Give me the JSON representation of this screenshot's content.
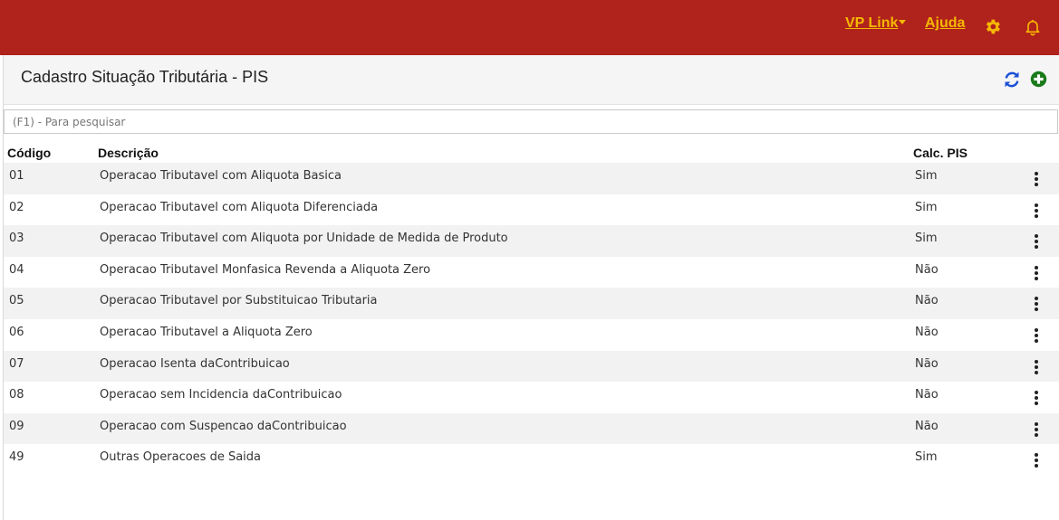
{
  "topbar": {
    "vp_link_label": "VP Link",
    "help_label": "Ajuda",
    "icons": [
      "chevron-down-icon",
      "gear-icon",
      "bell-icon"
    ],
    "colors": {
      "background": "#b0221c",
      "accent": "#f5b800"
    }
  },
  "page": {
    "title": "Cadastro Situação Tributária - PIS",
    "icons": [
      "refresh-icon",
      "add-icon"
    ]
  },
  "search": {
    "placeholder": "(F1) - Para pesquisar",
    "value": ""
  },
  "table": {
    "headers": {
      "code": "Código",
      "description": "Descrição",
      "calc_pis": "Calc. PIS"
    },
    "rows": [
      {
        "code": "01",
        "description": "Operacao Tributavel com Aliquota Basica",
        "calc_pis": "Sim"
      },
      {
        "code": "02",
        "description": "Operacao Tributavel com Aliquota Diferenciada",
        "calc_pis": "Sim"
      },
      {
        "code": "03",
        "description": "Operacao Tributavel com Aliquota por Unidade de Medida de Produto",
        "calc_pis": "Sim"
      },
      {
        "code": "04",
        "description": "Operacao Tributavel Monfasica Revenda a Aliquota Zero",
        "calc_pis": "Não"
      },
      {
        "code": "05",
        "description": "Operacao Tributavel por Substituicao Tributaria",
        "calc_pis": "Não"
      },
      {
        "code": "06",
        "description": "Operacao Tributavel a Aliquota Zero",
        "calc_pis": "Não"
      },
      {
        "code": "07",
        "description": "Operacao Isenta daContribuicao",
        "calc_pis": "Não"
      },
      {
        "code": "08",
        "description": "Operacao sem Incidencia daContribuicao",
        "calc_pis": "Não"
      },
      {
        "code": "09",
        "description": "Operacao com Suspencao daContribuicao",
        "calc_pis": "Não"
      },
      {
        "code": "49",
        "description": "Outras Operacoes de Saida",
        "calc_pis": "Sim"
      }
    ],
    "row_menu_icon": "more-vertical-icon"
  }
}
